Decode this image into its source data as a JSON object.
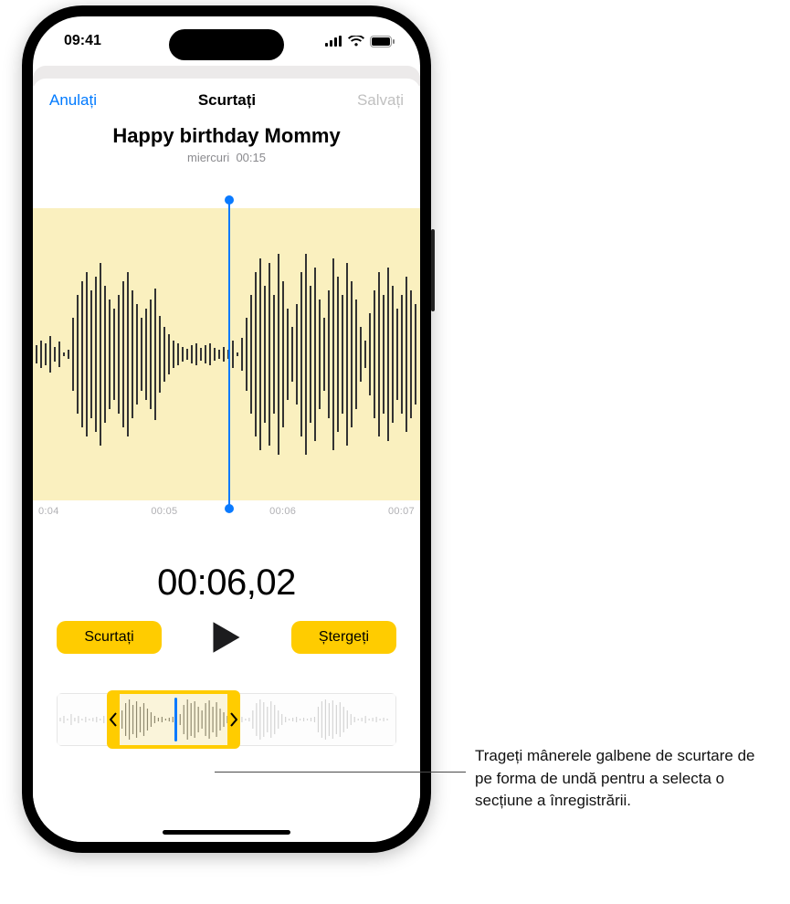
{
  "status": {
    "time": "09:41"
  },
  "nav": {
    "cancel": "Anulați",
    "title": "Scurtați",
    "save": "Salvați"
  },
  "recording": {
    "title": "Happy birthday Mommy",
    "day": "miercuri",
    "duration": "00:15"
  },
  "timeline": {
    "ticks": [
      "0:04",
      "00:05",
      "00:06",
      "00:07"
    ]
  },
  "current_time": "00:06,02",
  "controls": {
    "trim": "Scurtați",
    "delete": "Ștergeți"
  },
  "callout": {
    "text": "Trageți mânerele galbene de scurtare de pe forma de undă pentru a selecta o secțiune a înregistrării."
  }
}
